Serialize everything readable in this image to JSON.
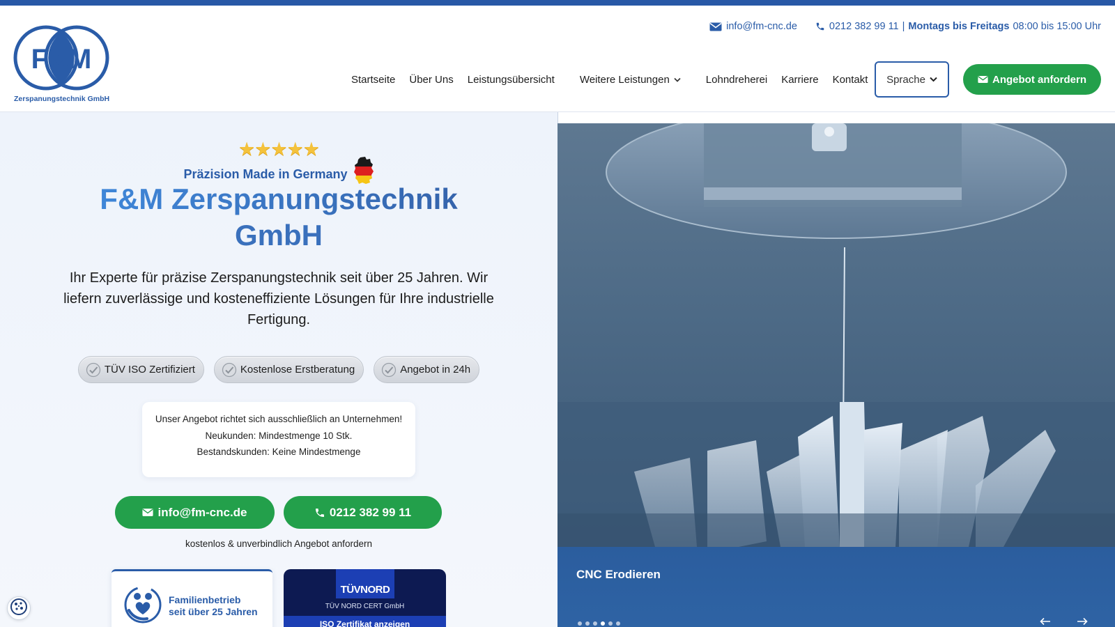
{
  "brand": {
    "logo_text": "F&M",
    "logo_subtitle": "Zerspanungstechnik GmbH",
    "primary_color": "#2a5ca8",
    "accent_green": "#23a04b"
  },
  "contact_bar": {
    "email": "info@fm-cnc.de",
    "phone": "0212 382 99 11",
    "separator": "|",
    "days": "Montags bis Freitags",
    "hours": "08:00 bis 15:00 Uhr"
  },
  "nav": {
    "items": [
      "Startseite",
      "Über Uns",
      "Leistungsübersicht"
    ],
    "more": "Weitere Leistungen",
    "items_after": [
      "Lohndreherei",
      "Karriere",
      "Kontakt"
    ],
    "language": "Sprache",
    "cta": "Angebot anfordern"
  },
  "hero": {
    "stars": "★★★★★",
    "rating": 5,
    "tagline": "Präzision Made in Germany",
    "title_line1": "F&M Zerspanungstechnik",
    "title_line2": "GmbH",
    "lead": "Ihr Experte für präzise Zerspanungstechnik seit über 25 Jahren. Wir liefern zuverlässige und kosteneffiziente Lösungen für Ihre industrielle Fertigung.",
    "badges": [
      "TÜV ISO Zertifiziert",
      "Kostenlose Erstberatung",
      "Angebot in 24h"
    ],
    "notice": {
      "line1": "Unser Angebot richtet sich ausschließlich an Unternehmen!",
      "line2": "Neukunden: Mindestmenge 10 Stk.",
      "line3": "Bestandskunden: Keine Mindestmenge"
    },
    "email_button": "info@fm-cnc.de",
    "phone_button": "0212 382 99 11",
    "free_note": "kostenlos & unverbindlich Angebot anfordern",
    "family_card": {
      "line1": "Familienbetrieb",
      "line2": "seit über 25 Jahren"
    },
    "tuv_card": {
      "logo": "TÜVNORD",
      "name": "TÜV NORD CERT GmbH",
      "button": "ISO Zertifikat anzeigen"
    }
  },
  "slider": {
    "caption": "CNC Erodieren",
    "slide_count": 6,
    "active_index": 3,
    "prev_icon": "arrow-left-icon",
    "next_icon": "arrow-right-icon"
  },
  "cookie": {
    "icon": "cookie-icon"
  }
}
